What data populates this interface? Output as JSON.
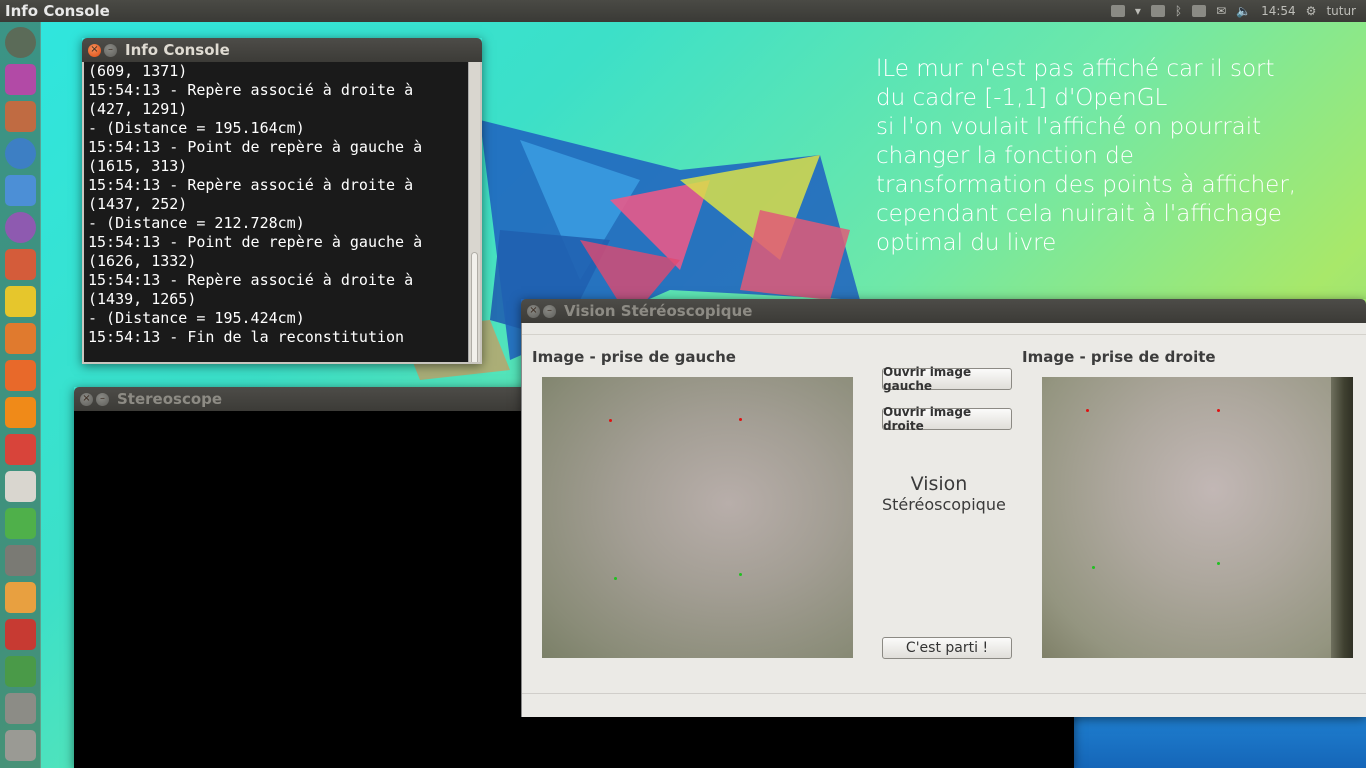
{
  "topbar": {
    "app_title": "Info Console",
    "clock": "14:54",
    "user": "tutur"
  },
  "desktop_note": "lLe mur n'est pas affiché car il sort\ndu cadre [-1,1] d'OpenGL\nsi l'on voulait l'affiché on pourrait\nchanger la fonction de\ntransformation des points à afficher,\ncependant cela nuirait à l'affichage\noptimal du livre",
  "console": {
    "title": "Info Console",
    "lines": [
      "(609, 1371)",
      "15:54:13 - Repère associé à droite à",
      "(427, 1291)",
      "- (Distance = 195.164cm)",
      "15:54:13 - Point de repère à gauche à",
      "(1615, 313)",
      "15:54:13 - Repère associé à droite à",
      "(1437, 252)",
      "- (Distance = 212.728cm)",
      "15:54:13 - Point de repère à gauche à",
      "(1626, 1332)",
      "15:54:13 - Repère associé à droite à",
      "(1439, 1265)",
      "- (Distance = 195.424cm)",
      "15:54:13 - Fin de la reconstitution"
    ]
  },
  "stereoscope": {
    "title": "Stereoscope"
  },
  "vision": {
    "title": "Vision Stéréoscopique",
    "left_label": "Image - prise de gauche",
    "right_label": "Image - prise de droite",
    "btn_open_left": "Ouvrir image gauche",
    "btn_open_right": "Ouvrir image droite",
    "heading_line1": "Vision",
    "heading_line2": "Stéréoscopique",
    "btn_go": "C'est parti !"
  },
  "colors": {
    "close_active": "#df4a12",
    "console_bg": "#1a1a1a",
    "window_bg": "#ebeae6"
  }
}
